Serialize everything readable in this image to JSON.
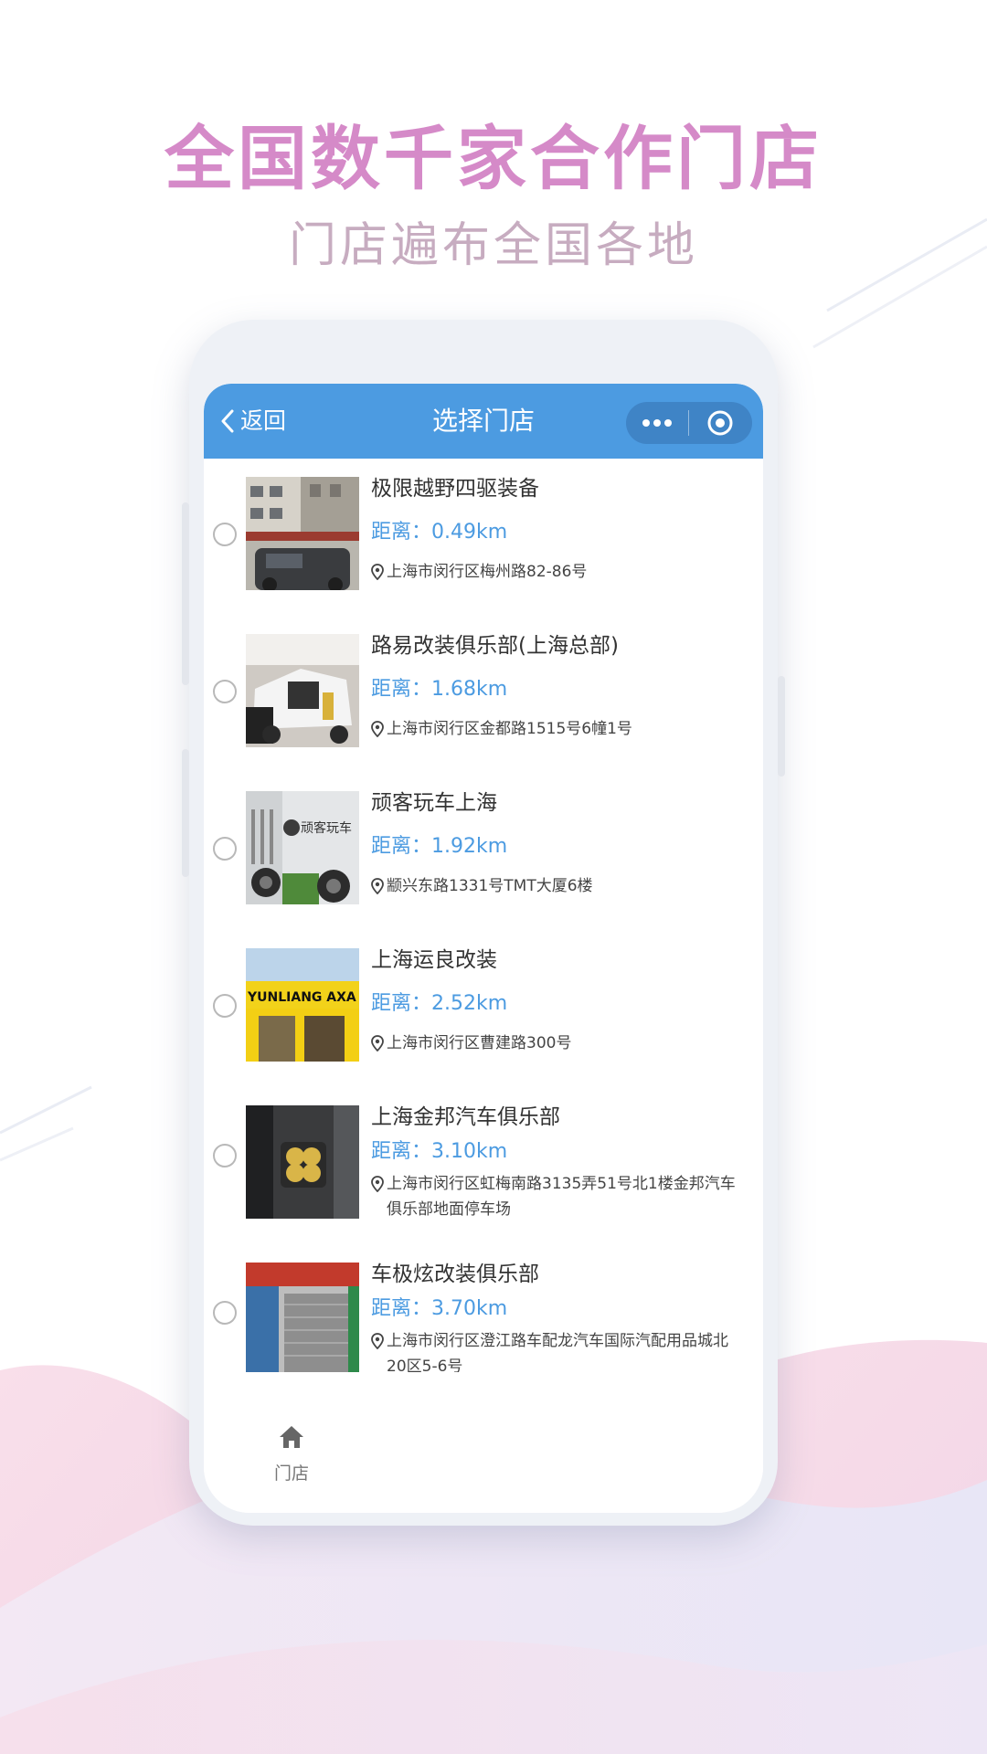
{
  "promo": {
    "headline": "全国数千家合作门店",
    "subline": "门店遍布全国各地"
  },
  "navbar": {
    "back_label": "返回",
    "title": "选择门店",
    "color": "#4c9be1"
  },
  "stores": [
    {
      "name": "极限越野四驱装备",
      "distance": "距离：0.49km",
      "address": "上海市闵行区梅州路82-86号"
    },
    {
      "name": "路易改装俱乐部(上海总部)",
      "distance": "距离：1.68km",
      "address": "上海市闵行区金都路1515号6幢1号"
    },
    {
      "name": "顽客玩车上海",
      "distance": "距离：1.92km",
      "address": "颛兴东路1331号TMT大厦6楼"
    },
    {
      "name": "上海运良改装",
      "distance": "距离：2.52km",
      "address": "上海市闵行区曹建路300号"
    },
    {
      "name": "上海金邦汽车俱乐部",
      "distance": "距离：3.10km",
      "address": "上海市闵行区虹梅南路3135弄51号北1楼金邦汽车俱乐部地面停车场"
    },
    {
      "name": "车极炫改装俱乐部",
      "distance": "距离：3.70km",
      "address": "上海市闵行区澄江路车配龙汽车国际汽配用品城北20区5-6号"
    }
  ],
  "thumb_texts": {
    "store_3_sign": "顽客玩车",
    "store_4_sign": "YUNLIANG AXA"
  },
  "tabbar": {
    "home_label": "门店"
  },
  "icons": [
    "back-chevron-icon",
    "more-dots-icon",
    "close-target-icon",
    "location-pin-icon",
    "home-icon"
  ]
}
